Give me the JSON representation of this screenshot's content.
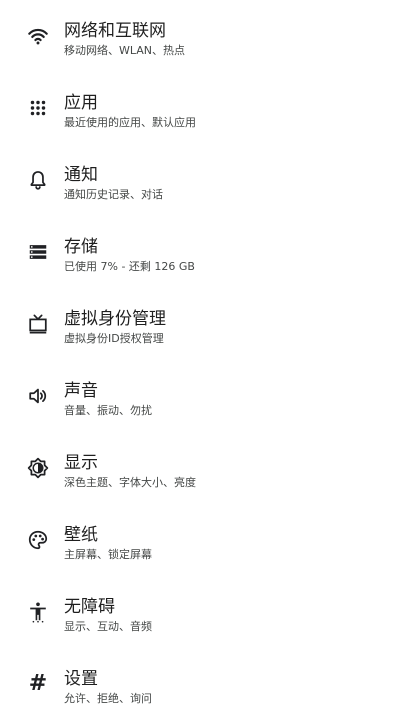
{
  "settings": {
    "items": [
      {
        "id": "network",
        "icon": "wifi-icon",
        "title": "网络和互联网",
        "subtitle": "移动网络、WLAN、热点"
      },
      {
        "id": "apps",
        "icon": "apps-grid-icon",
        "title": "应用",
        "subtitle": "最近使用的应用、默认应用"
      },
      {
        "id": "notifications",
        "icon": "bell-icon",
        "title": "通知",
        "subtitle": "通知历史记录、对话"
      },
      {
        "id": "storage",
        "icon": "storage-icon",
        "title": "存储",
        "subtitle": "已使用 7% - 还剩 126 GB"
      },
      {
        "id": "virtual-identity",
        "icon": "tv-icon",
        "title": "虚拟身份管理",
        "subtitle": "虚拟身份ID授权管理"
      },
      {
        "id": "sound",
        "icon": "speaker-icon",
        "title": "声音",
        "subtitle": "音量、振动、勿扰"
      },
      {
        "id": "display",
        "icon": "brightness-icon",
        "title": "显示",
        "subtitle": "深色主题、字体大小、亮度"
      },
      {
        "id": "wallpaper",
        "icon": "palette-icon",
        "title": "壁纸",
        "subtitle": "主屏幕、锁定屏幕"
      },
      {
        "id": "accessibility",
        "icon": "accessibility-icon",
        "title": "无障碍",
        "subtitle": "显示、互动、音频"
      },
      {
        "id": "settings",
        "icon": "hash-icon",
        "title": "设置",
        "subtitle": "允许、拒绝、询问"
      }
    ]
  },
  "icons": {
    "hash_glyph": "#"
  }
}
